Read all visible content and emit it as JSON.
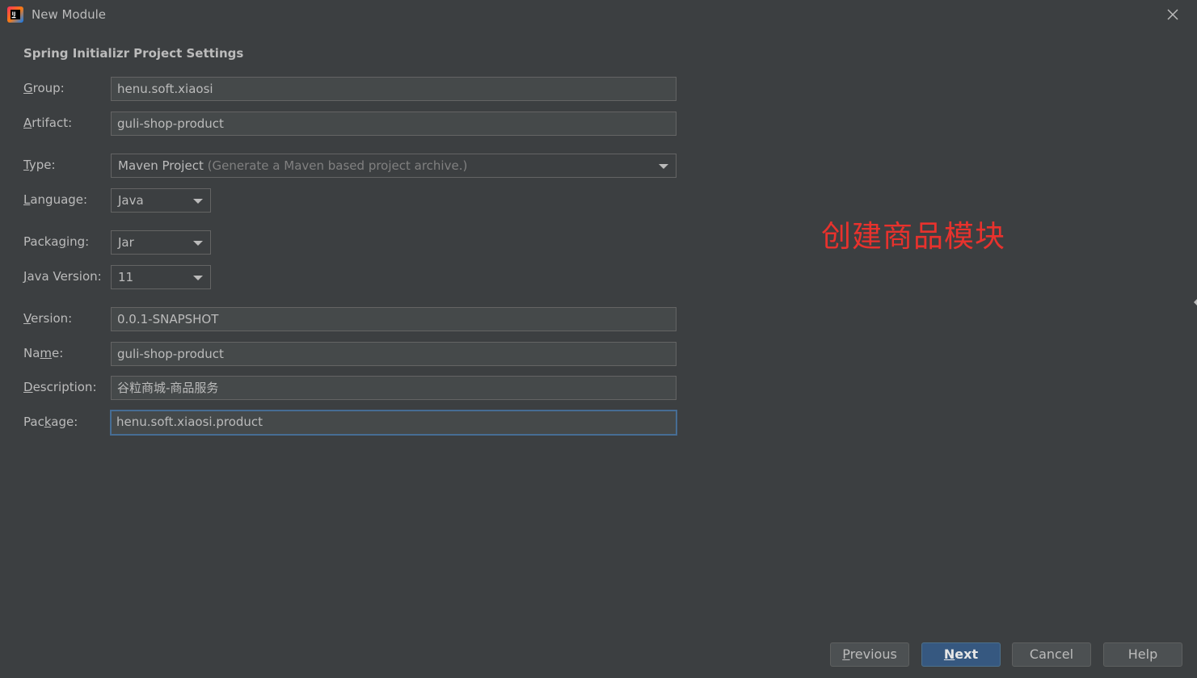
{
  "window": {
    "title": "New Module",
    "icon": "intellij-idea-icon",
    "close_icon": "close-icon"
  },
  "section": {
    "title": "Spring Initializr Project Settings"
  },
  "form": {
    "group": {
      "label_mnemonic": "G",
      "label_rest": "roup:",
      "value": "henu.soft.xiaosi"
    },
    "artifact": {
      "label_mnemonic": "A",
      "label_rest": "rtifact:",
      "value": "guli-shop-product"
    },
    "type": {
      "label_mnemonic": "T",
      "label_rest": "ype:",
      "value": "Maven Project",
      "hint": "(Generate a Maven based project archive.)"
    },
    "language": {
      "label_mnemonic": "L",
      "label_rest": "anguage:",
      "value": "Java"
    },
    "packaging": {
      "label_pre": "Packa",
      "label_mnemonic": "g",
      "label_rest": "ing:",
      "value": "Jar"
    },
    "java_version": {
      "label_mnemonic": "J",
      "label_rest": "ava Version:",
      "value": "11"
    },
    "version": {
      "label_mnemonic": "V",
      "label_rest": "ersion:",
      "value": "0.0.1-SNAPSHOT"
    },
    "name": {
      "label_pre": "Na",
      "label_mnemonic": "m",
      "label_rest": "e:",
      "value": "guli-shop-product"
    },
    "description": {
      "label_mnemonic": "D",
      "label_rest": "escription:",
      "value": "谷粒商城-商品服务"
    },
    "package": {
      "label_pre": "Pac",
      "label_mnemonic": "k",
      "label_rest": "age:",
      "value": "henu.soft.xiaosi.product"
    }
  },
  "annotation": {
    "text": "创建商品模块",
    "color": "#e8322d"
  },
  "buttons": {
    "previous": {
      "mnemonic": "P",
      "rest": "revious"
    },
    "next": {
      "mnemonic": "N",
      "rest": "ext"
    },
    "cancel": {
      "label": "Cancel"
    },
    "help": {
      "label": "Help"
    }
  },
  "colors": {
    "background": "#3c3f41",
    "field_bg": "#45494a",
    "focus_border": "#466d94",
    "primary_button": "#365880"
  }
}
